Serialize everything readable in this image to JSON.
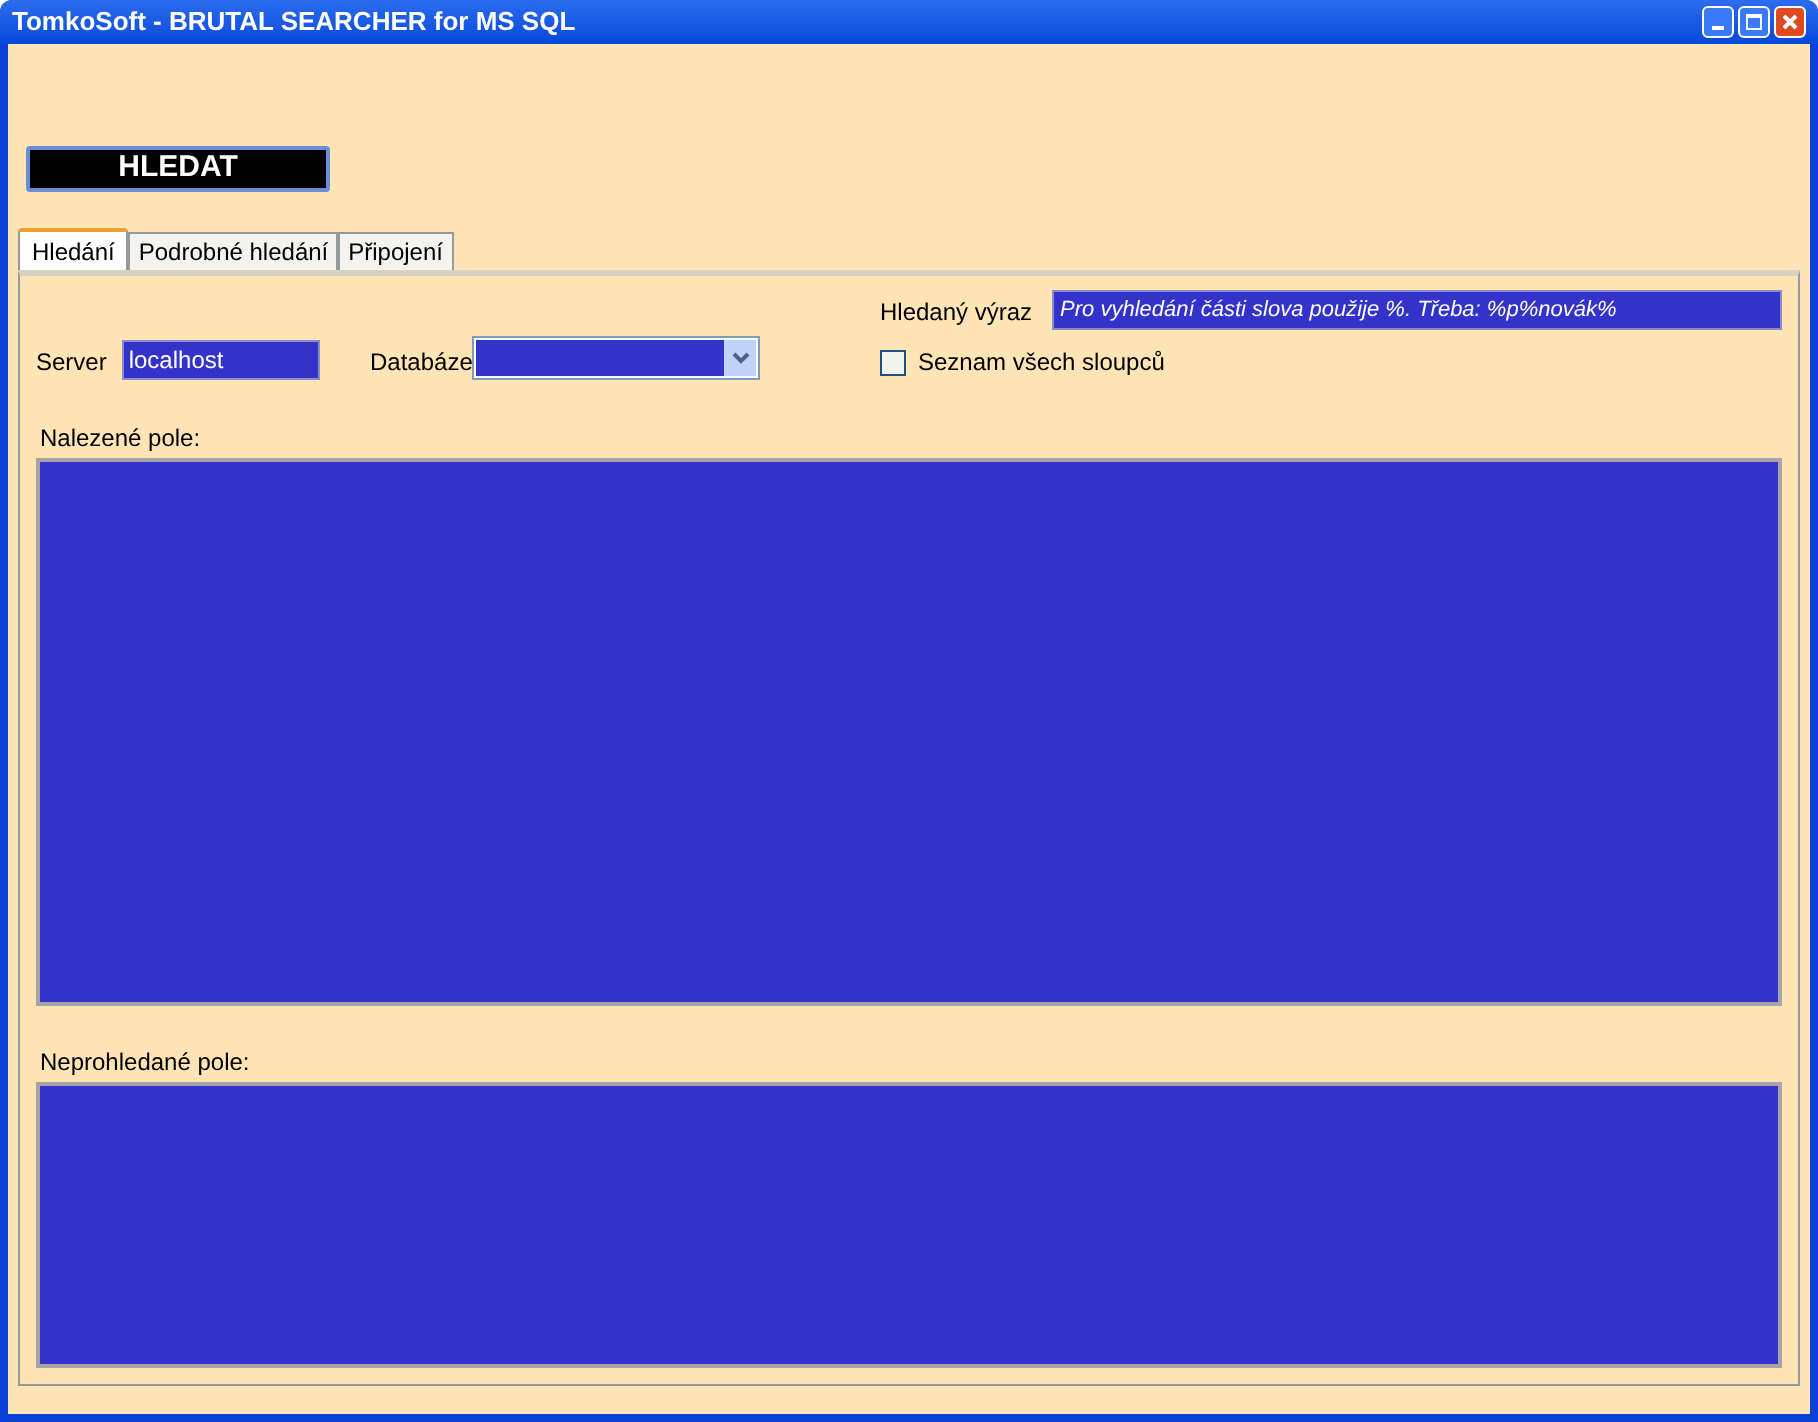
{
  "window": {
    "title": "TomkoSoft - BRUTAL SEARCHER for MS SQL"
  },
  "search_button": {
    "label": "HLEDAT"
  },
  "tabs": [
    {
      "label": "Hledání",
      "selected": true
    },
    {
      "label": "Podrobné hledání",
      "selected": false
    },
    {
      "label": "Připojení",
      "selected": false
    }
  ],
  "server": {
    "label": "Server",
    "value": "localhost"
  },
  "database": {
    "label": "Databáze"
  },
  "expression": {
    "label": "Hledaný výraz",
    "value": "Pro vyhledání části slova použije %. Třeba: %p%novák%"
  },
  "all_columns": {
    "label": "Seznam všech sloupců",
    "checked": false
  },
  "found_fields": {
    "label": "Nalezené pole:"
  },
  "unsearched_fields": {
    "label": "Neprohledané pole:"
  }
}
